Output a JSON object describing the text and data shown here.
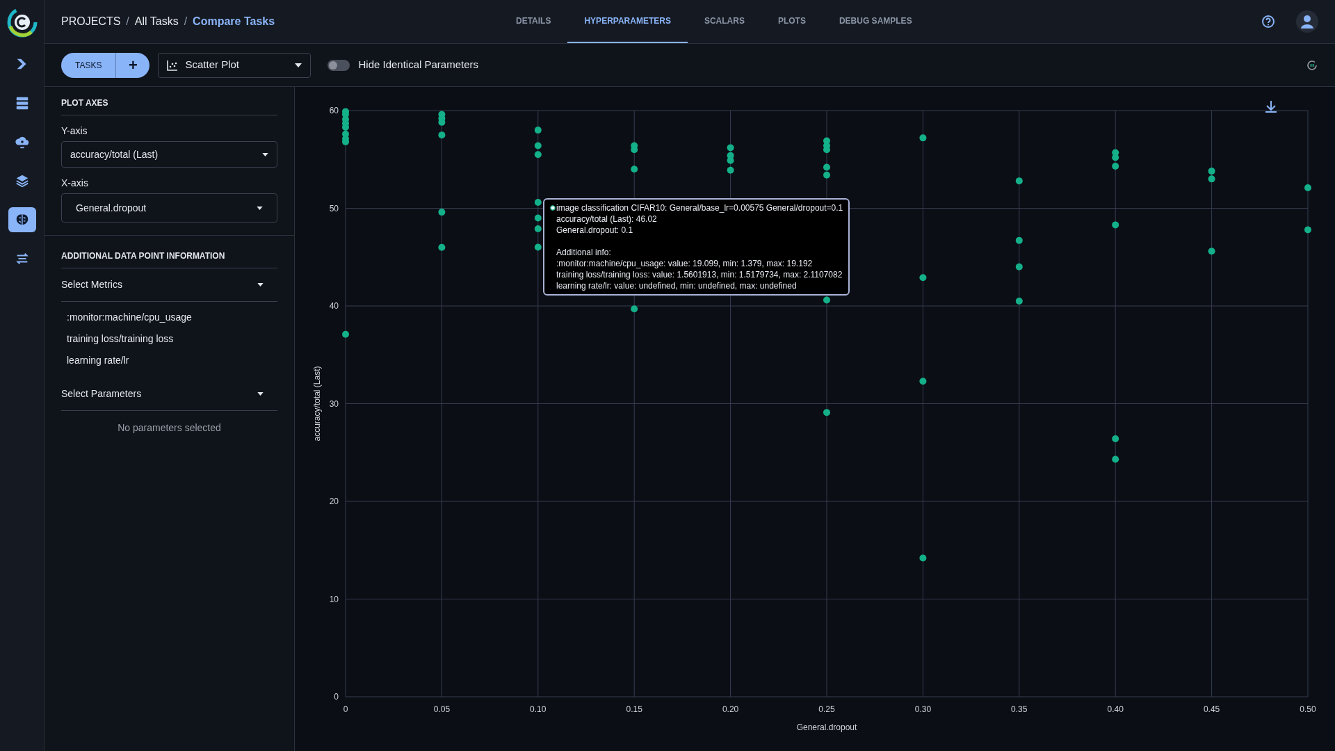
{
  "nav": [
    {
      "kind": "pipelines",
      "selected": false
    },
    {
      "kind": "datasets",
      "selected": false
    },
    {
      "kind": "cloud",
      "selected": false
    },
    {
      "kind": "layers",
      "selected": false
    },
    {
      "kind": "brain",
      "selected": true
    },
    {
      "kind": "swap",
      "selected": false
    }
  ],
  "breadcrumb": [
    {
      "label": "PROJECTS",
      "current": false
    },
    {
      "label": "All Tasks",
      "current": false
    },
    {
      "label": "Compare Tasks",
      "current": true
    }
  ],
  "breadcrumb_separator": "/",
  "tabs": [
    {
      "label": "DETAILS",
      "selected": false
    },
    {
      "label": "HYPERPARAMETERS",
      "selected": true
    },
    {
      "label": "SCALARS",
      "selected": false
    },
    {
      "label": "PLOTS",
      "selected": false
    },
    {
      "label": "DEBUG SAMPLES",
      "selected": false
    }
  ],
  "toolbar": {
    "tasks_button": "TASKS",
    "add_button": "+",
    "plot_type": "Scatter Plot",
    "toggle": {
      "label": "Hide Identical Parameters",
      "on": false
    }
  },
  "plot_axes": {
    "title": "PLOT AXES",
    "y_label": "Y-axis",
    "y_value": "accuracy/total (Last)",
    "x_label": "X-axis",
    "x_value": "General.dropout"
  },
  "additional_info": {
    "title": "ADDITIONAL DATA POINT INFORMATION",
    "metrics_select": "Select Metrics",
    "metrics": [
      ":monitor:machine/cpu_usage",
      "training loss/training loss",
      "learning rate/lr"
    ],
    "params_select": "Select Parameters",
    "params_empty": "No parameters selected"
  },
  "chart": {
    "chart_data": {
      "type": "scatter",
      "grid": true,
      "xlabel": "General.dropout",
      "ylabel": "accuracy/total (Last)",
      "xlim": [
        0,
        0.5
      ],
      "ylim": [
        0,
        60
      ],
      "xticks": [
        {
          "value": 0,
          "label": "0"
        },
        {
          "value": 0.05,
          "label": "0.05"
        },
        {
          "value": 0.1,
          "label": "0.10"
        },
        {
          "value": 0.15,
          "label": "0.15"
        },
        {
          "value": 0.2,
          "label": "0.20"
        },
        {
          "value": 0.25,
          "label": "0.25"
        },
        {
          "value": 0.3,
          "label": "0.30"
        },
        {
          "value": 0.35,
          "label": "0.35"
        },
        {
          "value": 0.4,
          "label": "0.40"
        },
        {
          "value": 0.45,
          "label": "0.45"
        },
        {
          "value": 0.5,
          "label": "0.50"
        }
      ],
      "yticks": [
        0,
        10,
        20,
        30,
        40,
        50,
        60
      ],
      "x": [
        0,
        0,
        0,
        0,
        0,
        0,
        0,
        0,
        0,
        0.05,
        0.05,
        0.05,
        0.05,
        0.05,
        0.05,
        0.1,
        0.1,
        0.1,
        0.1,
        0.1,
        0.1,
        0.1,
        0.15,
        0.15,
        0.15,
        0.15,
        0.2,
        0.2,
        0.2,
        0.2,
        0.25,
        0.25,
        0.25,
        0.25,
        0.25,
        0.25,
        0.25,
        0.3,
        0.3,
        0.3,
        0.3,
        0.35,
        0.35,
        0.35,
        0.35,
        0.4,
        0.4,
        0.4,
        0.4,
        0.4,
        0.4,
        0.45,
        0.45,
        0.45,
        0.5,
        0.5
      ],
      "series": [
        {
          "color": "#14b08a",
          "values": [
            59.9,
            59.6,
            59.1,
            58.7,
            58.3,
            57.6,
            57.1,
            56.8,
            37.1,
            59.6,
            59.2,
            58.8,
            57.5,
            49.6,
            46.0,
            58.0,
            56.4,
            55.5,
            50.6,
            49.0,
            47.9,
            46.02,
            56.4,
            56.0,
            54.0,
            39.7,
            56.2,
            55.4,
            54.9,
            53.9,
            56.9,
            56.4,
            56.0,
            54.2,
            53.4,
            40.6,
            29.1,
            57.2,
            42.9,
            32.3,
            14.2,
            52.8,
            46.7,
            44.0,
            40.5,
            55.7,
            55.2,
            54.3,
            48.3,
            26.4,
            24.3,
            53.8,
            53.0,
            45.6,
            52.1,
            47.8
          ]
        }
      ]
    },
    "tooltip": {
      "title": "image classification CIFAR10: General/base_lr=0.00575 General/dropout=0.1",
      "lines": [
        "accuracy/total (Last): 46.02",
        "General.dropout: 0.1"
      ],
      "additional_title": "Additional info:",
      "additional_lines": [
        ":monitor:machine/cpu_usage: value: 19.099, min: 1.379, max: 19.192",
        "training loss/training loss: value: 1.5601913, min: 1.5179734, max: 2.1107082",
        "learning rate/lr: value: undefined, min: undefined, max: undefined"
      ]
    }
  }
}
